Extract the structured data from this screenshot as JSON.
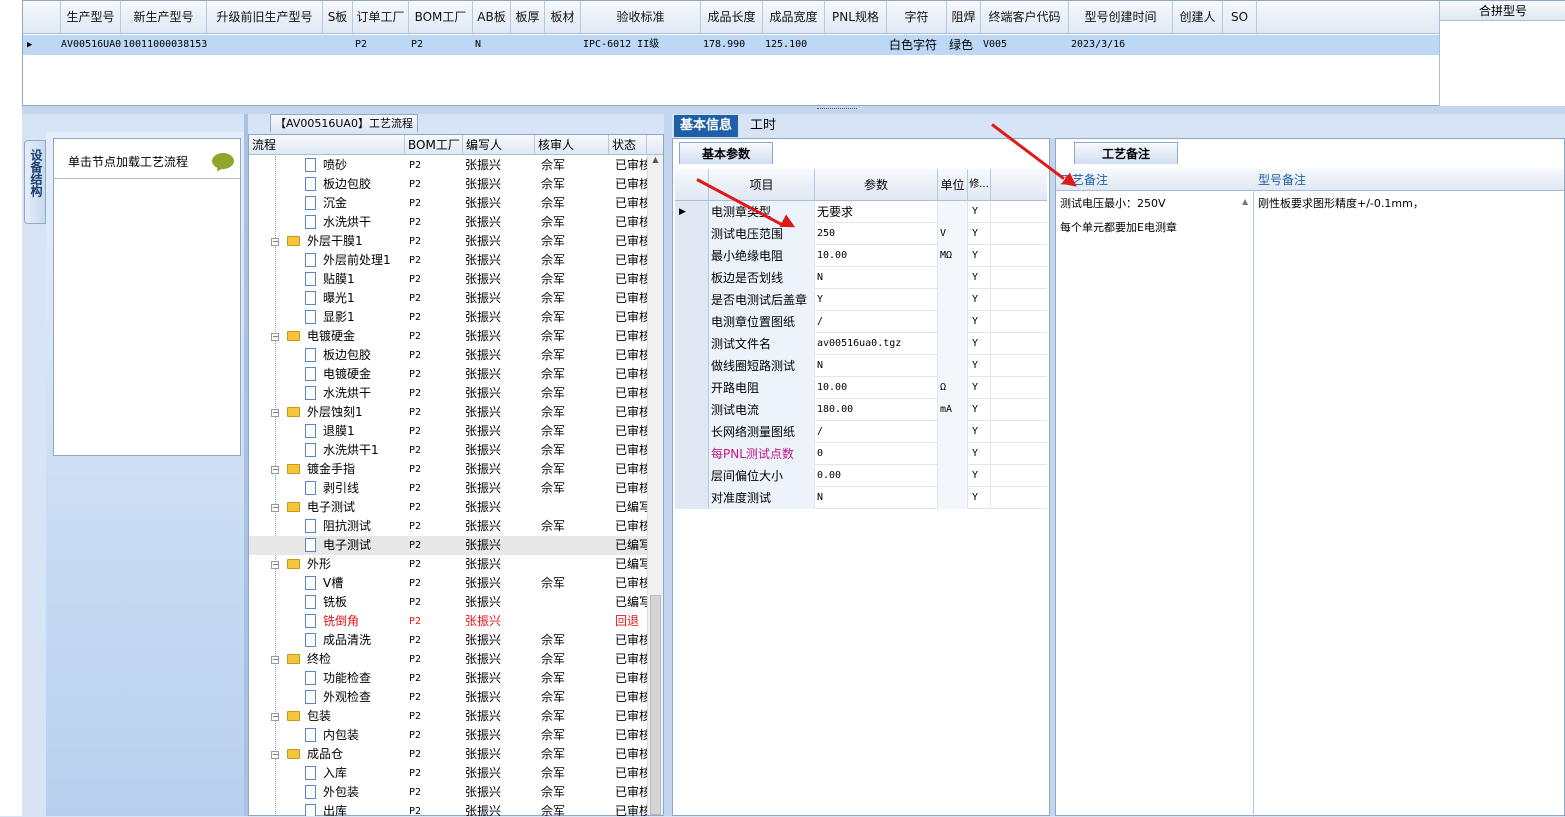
{
  "top_grid": {
    "headers": [
      "生产型号",
      "新生产型号",
      "升级前旧生产型号",
      "S板",
      "订单工厂",
      "BOM工厂",
      "AB板",
      "板厚",
      "板材",
      "验收标准",
      "成品长度",
      "成品宽度",
      "PNL规格",
      "字符",
      "阻焊",
      "终端客户代码",
      "型号创建时间",
      "创建人",
      "SO"
    ],
    "row": [
      "AV00516UA0",
      "10011000038153",
      "",
      "",
      "P2",
      "P2",
      "N",
      "",
      "",
      "IPC-6012 II级",
      "178.990",
      "125.100",
      "",
      "白色字符",
      "绿色",
      "V005",
      "2023/3/16",
      "",
      ""
    ],
    "combine_header": "合拼型号"
  },
  "left": {
    "side_tab": "设备结构",
    "node_hint": "单击节点加载工艺流程"
  },
  "process": {
    "title": "【AV00516UA0】工艺流程",
    "headers": [
      "流程",
      "BOM工厂",
      "编写人",
      "核审人",
      "状态"
    ],
    "rows": [
      {
        "name": "喷砂",
        "f": "P2",
        "w": "张振兴",
        "r": "佘军",
        "s": "已审核",
        "folder": false
      },
      {
        "name": "板边包胶",
        "f": "P2",
        "w": "张振兴",
        "r": "佘军",
        "s": "已审核",
        "folder": false
      },
      {
        "name": "沉金",
        "f": "P2",
        "w": "张振兴",
        "r": "佘军",
        "s": "已审核",
        "folder": false
      },
      {
        "name": "水洗烘干",
        "f": "P2",
        "w": "张振兴",
        "r": "佘军",
        "s": "已审核",
        "folder": false
      },
      {
        "name": "外层干膜1",
        "f": "P2",
        "w": "张振兴",
        "r": "佘军",
        "s": "已审核",
        "folder": true
      },
      {
        "name": "外层前处理1",
        "f": "P2",
        "w": "张振兴",
        "r": "佘军",
        "s": "已审核",
        "folder": false
      },
      {
        "name": "贴膜1",
        "f": "P2",
        "w": "张振兴",
        "r": "佘军",
        "s": "已审核",
        "folder": false
      },
      {
        "name": "曝光1",
        "f": "P2",
        "w": "张振兴",
        "r": "佘军",
        "s": "已审核",
        "folder": false
      },
      {
        "name": "显影1",
        "f": "P2",
        "w": "张振兴",
        "r": "佘军",
        "s": "已审核",
        "folder": false
      },
      {
        "name": "电镀硬金",
        "f": "P2",
        "w": "张振兴",
        "r": "佘军",
        "s": "已审核",
        "folder": true
      },
      {
        "name": "板边包胶",
        "f": "P2",
        "w": "张振兴",
        "r": "佘军",
        "s": "已审核",
        "folder": false
      },
      {
        "name": "电镀硬金",
        "f": "P2",
        "w": "张振兴",
        "r": "佘军",
        "s": "已审核",
        "folder": false
      },
      {
        "name": "水洗烘干",
        "f": "P2",
        "w": "张振兴",
        "r": "佘军",
        "s": "已审核",
        "folder": false
      },
      {
        "name": "外层蚀刻1",
        "f": "P2",
        "w": "张振兴",
        "r": "佘军",
        "s": "已审核",
        "folder": true
      },
      {
        "name": "退膜1",
        "f": "P2",
        "w": "张振兴",
        "r": "佘军",
        "s": "已审核",
        "folder": false
      },
      {
        "name": "水洗烘干1",
        "f": "P2",
        "w": "张振兴",
        "r": "佘军",
        "s": "已审核",
        "folder": false
      },
      {
        "name": "镀金手指",
        "f": "P2",
        "w": "张振兴",
        "r": "佘军",
        "s": "已审核",
        "folder": true
      },
      {
        "name": "剥引线",
        "f": "P2",
        "w": "张振兴",
        "r": "佘军",
        "s": "已审核",
        "folder": false
      },
      {
        "name": "电子测试",
        "f": "P2",
        "w": "张振兴",
        "r": "",
        "s": "已编写",
        "folder": true
      },
      {
        "name": "阻抗测试",
        "f": "P2",
        "w": "张振兴",
        "r": "佘军",
        "s": "已审核",
        "folder": false
      },
      {
        "name": "电子测试",
        "f": "P2",
        "w": "张振兴",
        "r": "",
        "s": "已编写",
        "folder": false,
        "selected": true
      },
      {
        "name": "外形",
        "f": "P2",
        "w": "张振兴",
        "r": "",
        "s": "已编写",
        "folder": true
      },
      {
        "name": "V槽",
        "f": "P2",
        "w": "张振兴",
        "r": "佘军",
        "s": "已审核",
        "folder": false
      },
      {
        "name": "铣板",
        "f": "P2",
        "w": "张振兴",
        "r": "",
        "s": "已编写",
        "folder": false
      },
      {
        "name": "铣倒角",
        "f": "P2",
        "w": "张振兴",
        "r": "",
        "s": "回退",
        "folder": false,
        "red": true
      },
      {
        "name": "成品清洗",
        "f": "P2",
        "w": "张振兴",
        "r": "佘军",
        "s": "已审核",
        "folder": false
      },
      {
        "name": "终检",
        "f": "P2",
        "w": "张振兴",
        "r": "佘军",
        "s": "已审核",
        "folder": true
      },
      {
        "name": "功能检查",
        "f": "P2",
        "w": "张振兴",
        "r": "佘军",
        "s": "已审核",
        "folder": false
      },
      {
        "name": "外观检查",
        "f": "P2",
        "w": "张振兴",
        "r": "佘军",
        "s": "已审核",
        "folder": false
      },
      {
        "name": "包装",
        "f": "P2",
        "w": "张振兴",
        "r": "佘军",
        "s": "已审核",
        "folder": true
      },
      {
        "name": "内包装",
        "f": "P2",
        "w": "张振兴",
        "r": "佘军",
        "s": "已审核",
        "folder": false
      },
      {
        "name": "成品仓",
        "f": "P2",
        "w": "张振兴",
        "r": "佘军",
        "s": "已审核",
        "folder": true
      },
      {
        "name": "入库",
        "f": "P2",
        "w": "张振兴",
        "r": "佘军",
        "s": "已审核",
        "folder": false
      },
      {
        "name": "外包装",
        "f": "P2",
        "w": "张振兴",
        "r": "佘军",
        "s": "已审核",
        "folder": false
      },
      {
        "name": "出库",
        "f": "P2",
        "w": "张振兴",
        "r": "佘军",
        "s": "已审核",
        "folder": false
      }
    ]
  },
  "tabs": {
    "basic": "基本信息",
    "time": "工时"
  },
  "params": {
    "tab": "基本参数",
    "headers": [
      "项目",
      "参数",
      "单位",
      "修..."
    ],
    "rows": [
      {
        "item": "电测章类型",
        "val": "无要求",
        "unit": "",
        "mod": "Y"
      },
      {
        "item": "测试电压范围",
        "val": "250",
        "unit": "V",
        "mod": "Y"
      },
      {
        "item": "最小绝缘电阻",
        "val": "10.00",
        "unit": "MΩ",
        "mod": "Y"
      },
      {
        "item": "板边是否划线",
        "val": "N",
        "unit": "",
        "mod": "Y"
      },
      {
        "item": "是否电测试后盖章",
        "val": "Y",
        "unit": "",
        "mod": "Y"
      },
      {
        "item": "电测章位置图纸",
        "val": "/",
        "unit": "",
        "mod": "Y"
      },
      {
        "item": "测试文件名",
        "val": "av00516ua0.tgz",
        "unit": "",
        "mod": "Y"
      },
      {
        "item": "做线圈短路测试",
        "val": "N",
        "unit": "",
        "mod": "Y"
      },
      {
        "item": "开路电阻",
        "val": "10.00",
        "unit": "Ω",
        "mod": "Y"
      },
      {
        "item": "测试电流",
        "val": "180.00",
        "unit": "mA",
        "mod": "Y"
      },
      {
        "item": "长网络测量图纸",
        "val": "/",
        "unit": "",
        "mod": "Y"
      },
      {
        "item": "每PNL测试点数",
        "val": "0",
        "unit": "",
        "mod": "Y",
        "pink": true
      },
      {
        "item": "层间偏位大小",
        "val": "0.00",
        "unit": "",
        "mod": "Y"
      },
      {
        "item": "对准度测试",
        "val": "N",
        "unit": "",
        "mod": "Y"
      }
    ]
  },
  "notes": {
    "tab": "工艺备注",
    "header_left": "工艺备注",
    "header_right": "型号备注",
    "process_note_1": "测试电压最小：250V",
    "process_note_2": "每个单元都要加E电测章",
    "model_note": "刚性板要求图形精度+/-0.1mm，"
  },
  "colors": {
    "accent": "#1f5fa8",
    "annotation_arrow": "#e01818",
    "selected_row": "#bcd8f4"
  }
}
